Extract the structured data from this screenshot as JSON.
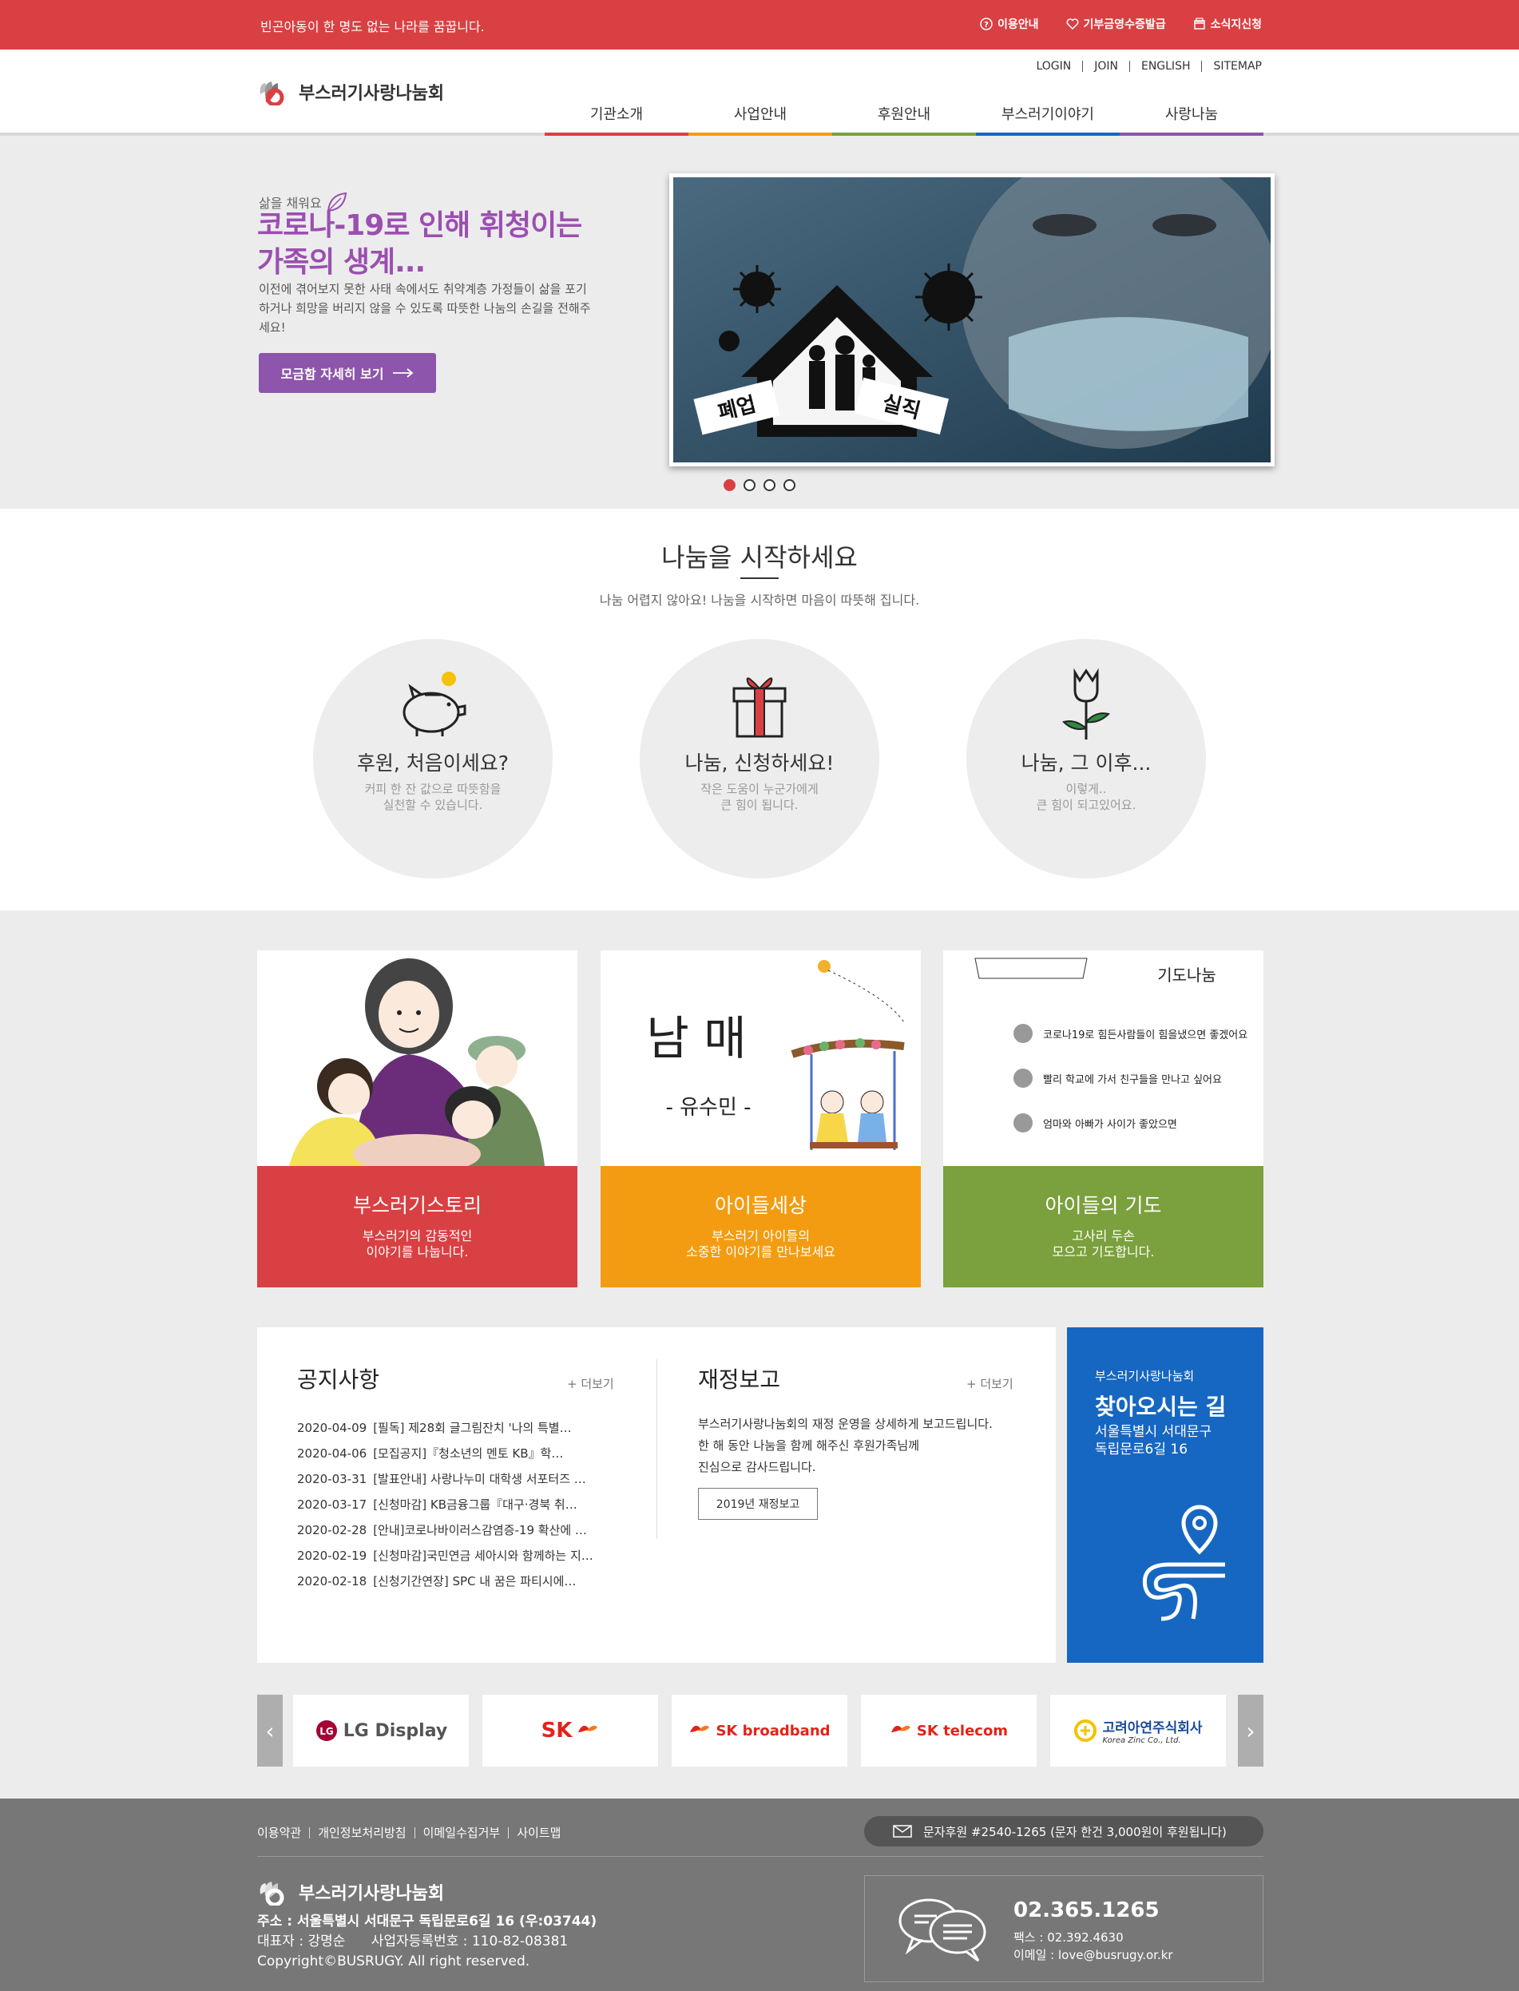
{
  "topbar": {
    "slogan": "빈곤아동이 한 명도 없는 나라를 꿈꿉니다.",
    "links": [
      "이용안내",
      "기부금영수증발급",
      "소식지신청"
    ]
  },
  "header": {
    "logo": "부스러기사랑나눔회",
    "util": [
      "LOGIN",
      "JOIN",
      "ENGLISH",
      "SITEMAP"
    ],
    "nav": [
      {
        "label": "기관소개",
        "color": "#d94043"
      },
      {
        "label": "사업안내",
        "color": "#f39c12"
      },
      {
        "label": "후원안내",
        "color": "#7ba03e"
      },
      {
        "label": "부스러기이야기",
        "color": "#1667c1"
      },
      {
        "label": "사랑나눔",
        "color": "#8d55ab"
      }
    ]
  },
  "hero": {
    "sub": "삶을 채워요",
    "title": "코로나-19로 인해 휘청이는 가족의 생계...",
    "desc": "이전에 겪어보지 못한 사태 속에서도 취약계층 가정들이 삶을 포기하거나 희망을 버리지 않을 수 있도록 따뜻한 나눔의 손길을 전해주세요!",
    "button": "모금함 자세히 보기",
    "image_labels": [
      "폐업",
      "실직"
    ],
    "active_slide": 1,
    "slide_count": 4
  },
  "start": {
    "title": "나눔을 시작하세요",
    "sub": "나눔 어렵지 않아요! 나눔을 시작하면 마음이 따뜻해 집니다.",
    "items": [
      {
        "title": "후원, 처음이세요?",
        "desc1": "커피 한 잔 값으로 따뜻함을",
        "desc2": "실천할 수 있습니다.",
        "icon": "piggy-bank-icon"
      },
      {
        "title": "나눔, 신청하세요!",
        "desc1": "작은 도움이 누군가에게",
        "desc2": "큰 힘이 됩니다.",
        "icon": "gift-icon"
      },
      {
        "title": "나눔, 그 이후...",
        "desc1": "이렇게..",
        "desc2": "큰 힘이 되고있어요.",
        "icon": "flower-icon"
      }
    ]
  },
  "cards": [
    {
      "title": "부스러기스토리",
      "desc1": "부스러기의 감동적인",
      "desc2": "이야기를 나눕니다.",
      "color": "#d94043"
    },
    {
      "title": "아이들세상",
      "desc1": "부스러기 아이들의",
      "desc2": "소중한 이야기를 만나보세요",
      "color": "#f39c12",
      "img_title": "남 매",
      "img_author": "- 유수민 -"
    },
    {
      "title": "아이들의 기도",
      "desc1": "고사리 두손",
      "desc2": "모으고 기도합니다.",
      "color": "#7ba03e",
      "img_title": "기도나눔",
      "img_lines": [
        "코로나19로 힘든사람들이 힘을냈으면 좋겠어요",
        "빨리 학교에 가서 친구들을 만나고 싶어요",
        "엄마와 아빠가 사이가 좋았으면"
      ]
    }
  ],
  "notice": {
    "title": "공지사항",
    "more": "+ 더보기",
    "items": [
      {
        "date": "2020-04-09",
        "text": "[필독] 제28회 글그림잔치 '나의 특별…"
      },
      {
        "date": "2020-04-06",
        "text": "[모집공지]『청소년의 멘토 KB』학…"
      },
      {
        "date": "2020-03-31",
        "text": "[발표안내] 사랑나누미 대학생 서포터즈 …"
      },
      {
        "date": "2020-03-17",
        "text": "[신청마감] KB금융그룹『대구·경북 취…"
      },
      {
        "date": "2020-02-28",
        "text": "[안내]코로나바이러스감염증-19 확산에 …"
      },
      {
        "date": "2020-02-19",
        "text": "[신청마감]국민연금 세아시와 함께하는 지…"
      },
      {
        "date": "2020-02-18",
        "text": "[신청기간연장] SPC 내 꿈은 파티시에…"
      }
    ]
  },
  "finance": {
    "title": "재정보고",
    "more": "+ 더보기",
    "desc": [
      "부스러기사랑나눔회의 재정 운영을 상세하게 보고드립니다.",
      "한 해 동안 나눔을 함께 해주신 후원가족님께",
      "진심으로 감사드립니다."
    ],
    "button": "2019년 재정보고"
  },
  "map": {
    "org": "부스러기사랑나눔회",
    "title": "찾아오시는 길",
    "addr1": "서울특별시 서대문구",
    "addr2": "독립문로6길 16"
  },
  "partners": [
    {
      "name": "LG Display",
      "color": "#555555"
    },
    {
      "name": "SK",
      "color": "#e2231a"
    },
    {
      "name": "SK broadband",
      "color": "#e2231a"
    },
    {
      "name": "SK telecom",
      "color": "#e2231a"
    },
    {
      "name": "고려아연주식회사",
      "sub": "Korea Zinc Co., Ltd.",
      "color": "#1a4a99"
    }
  ],
  "footer": {
    "links": [
      "이용약관",
      "개인정보처리방침",
      "이메일수집거부",
      "사이트맵"
    ],
    "sms": "문자후원 #2540-1265 (문자 한건 3,000원이 후원됩니다)",
    "logo": "부스러기사랑나눔회",
    "address": "주소 : 서울특별시 서대문구 독립문로6길 16 (우:03744)",
    "rep": "대표자 : 강명순      사업자등록번호 : 110-82-08381",
    "copyright": "Copyright©BUSRUGY. All right reserved.",
    "tel": "02.365.1265",
    "fax": "팩스 : 02.392.4630",
    "email": "이메일 : love@busrugy.or.kr"
  }
}
